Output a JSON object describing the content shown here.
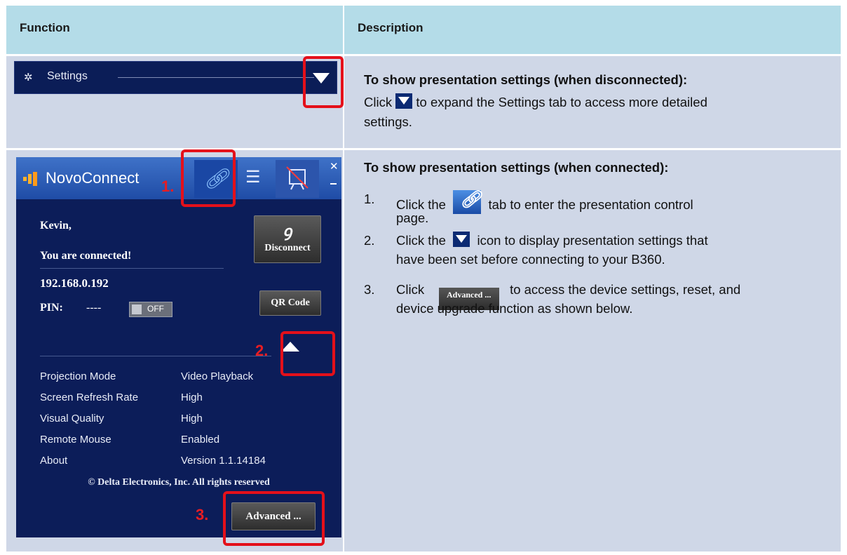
{
  "table": {
    "header": {
      "function": "Function",
      "description": "Description"
    }
  },
  "row1": {
    "settings_bar_label": "Settings",
    "title": "To show presentation settings (when disconnected):",
    "text_before": "Click",
    "text_after": "to expand the Settings tab to access more detailed",
    "text_line2": "settings."
  },
  "row2": {
    "title": "To show presentation settings (when connected):",
    "steps": [
      {
        "num": "1.",
        "a": "Click the",
        "b": "tab to enter the presentation control",
        "c": "page."
      },
      {
        "num": "2.",
        "a": "Click the",
        "b": "icon to display presentation settings that",
        "c": "have been set before connecting to your B360."
      },
      {
        "num": "3.",
        "a": "Click",
        "b": "to access the device settings, reset, and",
        "c": "device upgrade function as shown below."
      }
    ],
    "inline_advanced_label": "Advanced ..."
  },
  "callouts": {
    "one": "1.",
    "two": "2.",
    "three": "3."
  },
  "panel": {
    "app_name_novo": "Novo",
    "app_name_connect": "Connect",
    "user": "Kevin,",
    "status": "You are connected!",
    "disconnect_label": "Disconnect",
    "ip": "192.168.0.192",
    "pin_label": "PIN:",
    "pin_value": "----",
    "toggle_label": "OFF",
    "qr_label": "QR Code",
    "settings": [
      {
        "name": "Projection Mode",
        "value": "Video Playback"
      },
      {
        "name": "Screen Refresh Rate",
        "value": "High"
      },
      {
        "name": "Visual Quality",
        "value": "High"
      },
      {
        "name": "Remote Mouse",
        "value": "Enabled"
      },
      {
        "name": "About",
        "value": "Version  1.1.14184"
      }
    ],
    "copyright": "© Delta Electronics, Inc. All rights reserved",
    "advanced_label": "Advanced ..."
  },
  "colors": {
    "header_bg": "#b4dce8",
    "row_bg": "#cfd7e7",
    "panel_bg": "#0c1d59",
    "callout_red": "#e4101a"
  }
}
